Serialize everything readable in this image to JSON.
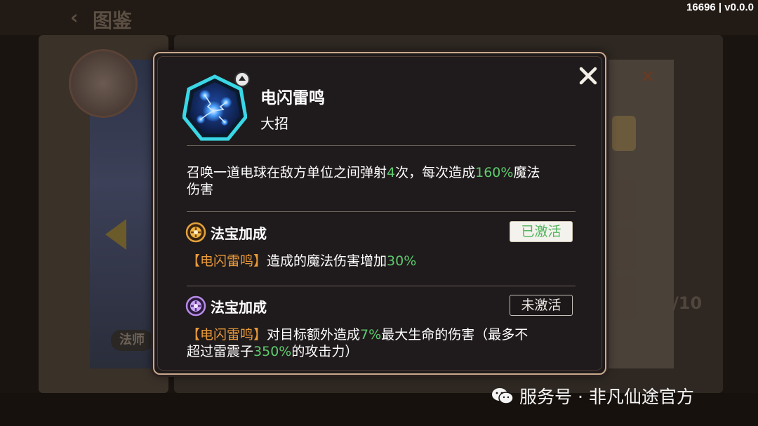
{
  "background": {
    "title": "图鉴",
    "version": "16696 | v0.0.0",
    "class_label": "法师",
    "count": "/10"
  },
  "skill": {
    "name": "电闪雷鸣",
    "type": "大招",
    "description_parts": [
      "召唤一道电球在敌方单位之间弹射",
      "4",
      "次，每次造成",
      "160%",
      "魔法",
      "伤害"
    ]
  },
  "bonuses": [
    {
      "title": "法宝加成",
      "status": "已激活",
      "active": true,
      "text_parts": [
        "【电闪雷鸣】",
        "造成的魔法伤害增加",
        "30%"
      ]
    },
    {
      "title": "法宝加成",
      "status": "未激活",
      "active": false,
      "text_parts": [
        "【电闪雷鸣】",
        "对目标额外造成",
        "7%",
        "最大生命的伤害（最多不",
        "超过雷震子",
        "350%",
        "的攻击力）"
      ]
    }
  ],
  "watermark": {
    "text": "服务号 · 非凡仙途官方"
  },
  "colors": {
    "highlight_green": "#5ecb6f",
    "highlight_orange": "#e99a3a",
    "modal_border": "#c9a98b"
  }
}
